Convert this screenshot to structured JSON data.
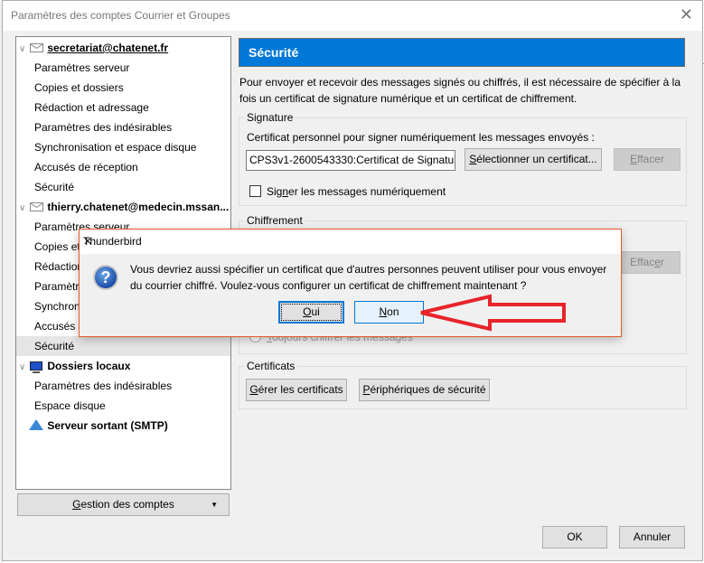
{
  "window": {
    "title": "Paramètres des comptes Courrier et Groupes",
    "close_icon": "close-icon"
  },
  "tree": {
    "accounts": [
      {
        "label": "secretariat@chatenet.fr",
        "icon": "mail-icon",
        "expanded": true,
        "children": [
          "Paramètres serveur",
          "Copies et dossiers",
          "Rédaction et adressage",
          "Paramètres des indésirables",
          "Synchronisation et espace disque",
          "Accusés de réception",
          "Sécurité"
        ]
      },
      {
        "label": "thierry.chatenet@medecin.mssan...",
        "icon": "mail-icon",
        "expanded": true,
        "children": [
          "Paramètres serveur",
          "Copies et dossiers",
          "Rédaction et adressage",
          "Paramètres des indésirables",
          "Synchronisation et espace disque",
          "Accusés de réception",
          "Sécurité"
        ]
      },
      {
        "label": "Dossiers locaux",
        "icon": "computer-icon",
        "expanded": true,
        "children": [
          "Paramètres des indésirables",
          "Espace disque"
        ]
      },
      {
        "label": "Serveur sortant (SMTP)",
        "icon": "smtp-server-icon",
        "children": []
      }
    ],
    "selected": "thierry.chatenet@medecin.mssan... > Sécurité"
  },
  "manage_button": {
    "label_prefix": "",
    "label_ul": "G",
    "label_rest": "estion des comptes"
  },
  "security": {
    "header": "Sécurité",
    "intro": "Pour envoyer et recevoir des messages signés ou chiffrés, il est nécessaire de spécifier à la fois un certificat de signature numérique et un certificat de chiffrement.",
    "signature": {
      "legend": "Signature",
      "cert_label": "Certificat personnel pour signer numériquement les messages envoyés :",
      "cert_value": "CPS3v1-2600543330:Certificat de Signature",
      "select_ul": "S",
      "select_rest": "électionner un certificat...",
      "clear_ul": "E",
      "clear_rest": "ffacer",
      "sign_pre": "Sig",
      "sign_ul": "n",
      "sign_rest": "er les messages numériquement",
      "sign_checked": false
    },
    "encryption": {
      "legend": "Chiffrement",
      "clear_pre": "Effac",
      "clear_ul": "e",
      "clear_rest": "r",
      "always_ul": "T",
      "always_rest": "oujours chiffrer les messages"
    },
    "certificates": {
      "legend": "Certificats",
      "manage_ul": "G",
      "manage_rest": "érer les certificats",
      "devices_ul": "P",
      "devices_rest": "ériphériques de sécurité"
    }
  },
  "footer": {
    "ok": "OK",
    "cancel": "Annuler"
  },
  "modal": {
    "title": "Thunderbird",
    "icon": "question-icon",
    "message_line1": "Vous devriez aussi spécifier un certificat que d'autres personnes peuvent utiliser pour vous envoyer",
    "message_line2": "du courrier chiffré. Voulez-vous configurer un certificat de chiffrement maintenant ?",
    "yes_ul": "O",
    "yes_rest": "ui",
    "no_ul": "N",
    "no_rest": "on",
    "annotation_color": "#e8232a"
  }
}
